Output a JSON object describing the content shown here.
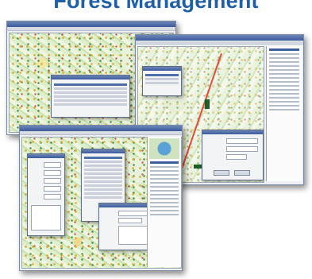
{
  "header": {
    "title": "Forest Management"
  }
}
